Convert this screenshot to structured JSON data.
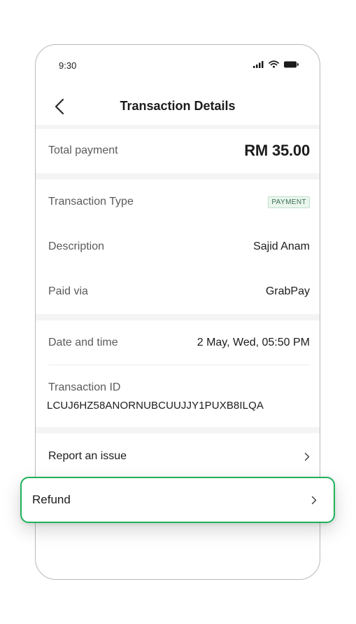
{
  "status_bar": {
    "time": "9:30"
  },
  "header": {
    "title": "Transaction Details"
  },
  "total": {
    "label": "Total payment",
    "value": "RM 35.00"
  },
  "details": {
    "type_label": "Transaction Type",
    "type_badge": "PAYMENT",
    "description_label": "Description",
    "description_value": "Sajid Anam",
    "paid_via_label": "Paid via",
    "paid_via_value": "GrabPay"
  },
  "meta": {
    "datetime_label": "Date and time",
    "datetime_value": "2 May, Wed, 05:50 PM",
    "txid_label": "Transaction ID",
    "txid_value": "LCUJ6HZ58ANORNUBCUUJJY1PUXB8ILQA"
  },
  "actions": {
    "report_label": "Report an issue",
    "refund_label": "Refund"
  },
  "colors": {
    "accent_green": "#1fb25a",
    "badge_bg": "#eaf6ee",
    "badge_text": "#3c6e4f",
    "band_gray": "#f4f4f4"
  },
  "icons": [
    "signal-icon",
    "wifi-icon",
    "battery-icon",
    "back-arrow-icon",
    "chevron-right-icon"
  ]
}
